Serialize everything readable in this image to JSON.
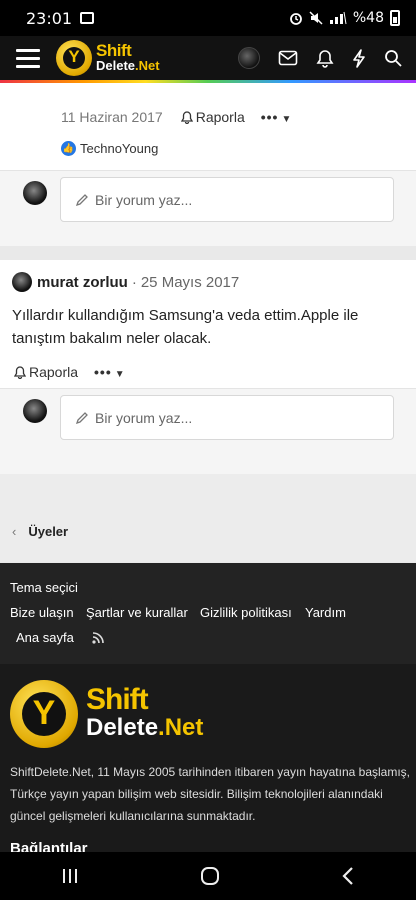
{
  "status": {
    "time": "23:01",
    "battery": "%48"
  },
  "header": {
    "logo_line1": "Shift",
    "logo_line2": "Delete",
    "logo_net": ".Net"
  },
  "post1": {
    "date": "11 Haziran 2017",
    "report_label": "Raporla",
    "more_label": "•••",
    "liker": "TechnoYoung",
    "comment_placeholder": "Bir yorum yaz..."
  },
  "post2": {
    "author": "murat zorluu",
    "separator": "·",
    "date": "25 Mayıs 2017",
    "text": "Yıllardır kullandığım Samsung'a veda ettim.Apple ile tanıştım bakalım neler olacak.",
    "report_label": "Raporla",
    "more_label": "•••",
    "comment_placeholder": "Bir yorum yaz..."
  },
  "breadcrumb": {
    "label": "Üyeler"
  },
  "footer": {
    "theme": "Tema seçici",
    "contact": "Bize ulaşın",
    "terms": "Şartlar ve kurallar",
    "privacy": "Gizlilik politikası",
    "help": "Yardım",
    "home": "Ana sayfa",
    "brand_line1": "Shift",
    "brand_line2": "Delete",
    "brand_net": ".Net",
    "about": "ShiftDelete.Net, 11 Mayıs 2005 tarihinden itibaren yayın hayatına başlamış, Türkçe yayın yapan bilişim web sitesidir. Bilişim teknolojileri alanındaki güncel gelişmeleri kullanıcılarına sunmaktadır.",
    "links_heading": "Bağlantılar"
  },
  "icons": [
    "menu-icon",
    "avatar",
    "mail-icon",
    "bell-icon",
    "bolt-icon",
    "search-icon",
    "rss-icon"
  ]
}
